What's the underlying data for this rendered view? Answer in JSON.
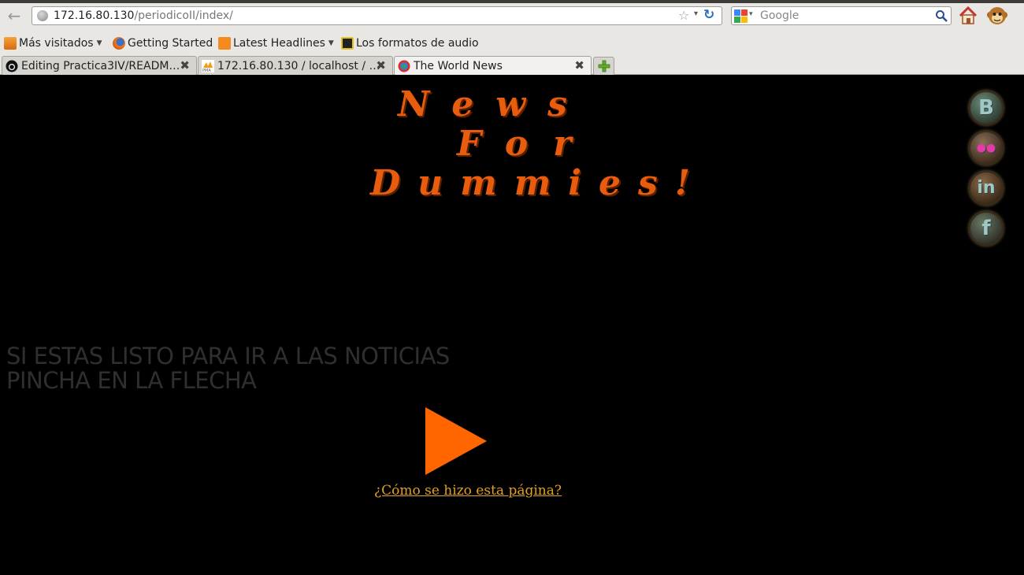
{
  "browser": {
    "url_host": "172.16.80.130",
    "url_path": "/periodicoII/index/",
    "search_placeholder": "Google",
    "bookmarks": [
      {
        "label": "Más visitados",
        "has_dropdown": true,
        "icon": "rss-folder-icon"
      },
      {
        "label": "Getting Started",
        "has_dropdown": false,
        "icon": "firefox-icon"
      },
      {
        "label": "Latest Headlines",
        "has_dropdown": true,
        "icon": "rss-icon"
      },
      {
        "label": "Los formatos de audio",
        "has_dropdown": false,
        "icon": "page-icon"
      }
    ],
    "tabs": [
      {
        "title": "Editing Practica3IV/READM…",
        "icon": "github-icon",
        "active": false
      },
      {
        "title": "172.16.80.130 / localhost / …",
        "icon": "phpmyadmin-icon",
        "active": false
      },
      {
        "title": "The World News",
        "icon": "globe-icon",
        "active": true
      }
    ],
    "colors": {
      "chrome_bg": "#e8e7e3",
      "link_blue": "#2a6ebd"
    }
  },
  "page": {
    "logo_lines": [
      "News",
      "For",
      "Dummies!"
    ],
    "social_icons": [
      {
        "name": "blogger-icon",
        "glyph": "B"
      },
      {
        "name": "flickr-icon",
        "glyph": "●●"
      },
      {
        "name": "linkedin-icon",
        "glyph": "in"
      },
      {
        "name": "facebook-icon",
        "glyph": "f"
      }
    ],
    "prompt_line1": "SI ESTAS LISTO PARA IR A LAS NOTICIAS",
    "prompt_line2": "PINCHA EN LA FLECHA",
    "how_link": "¿Cómo se hizo esta página?",
    "colors": {
      "background": "#000000",
      "logo": "#e85c0d",
      "arrow": "#ff6600",
      "link": "#e0a020",
      "prompt": "#2f2f2f"
    }
  }
}
